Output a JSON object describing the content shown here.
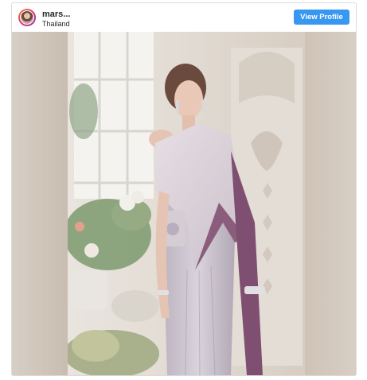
{
  "post": {
    "username": "mars...",
    "location": "Thailand",
    "view_profile_label": "View Profile"
  },
  "icons": {
    "avatar": "profile-avatar"
  },
  "colors": {
    "button": "#3897f0",
    "border": "#dbdbdb"
  }
}
